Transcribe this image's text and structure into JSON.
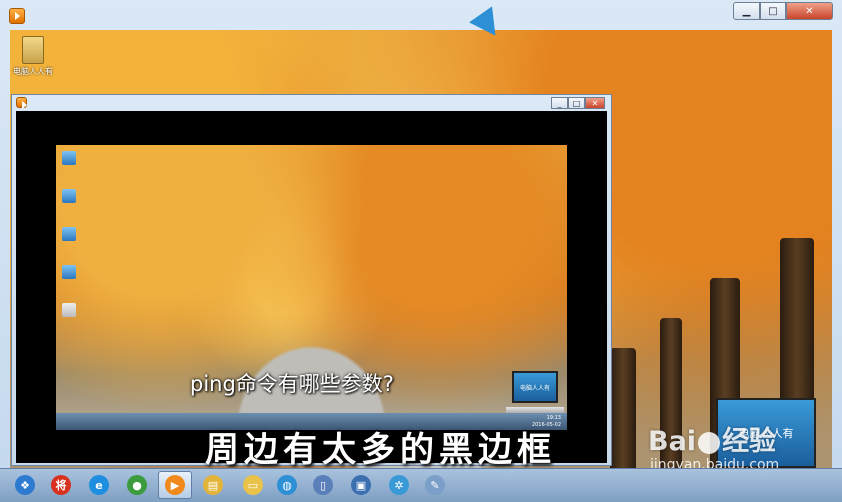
{
  "window": {
    "minimize_glyph": "▁",
    "maximize_glyph": "□",
    "close_glyph": "✕"
  },
  "desktop": {
    "icon_label": "电脑人人有"
  },
  "inner_window": {
    "minimize_glyph": "_",
    "maximize_glyph": "□",
    "close_glyph": "✕"
  },
  "screen": {
    "question_text": "ping命令有哪些参数?",
    "mini_clock_time": "19:13",
    "mini_clock_date": "2016-05-02",
    "laptop_label": "电脑人人有"
  },
  "caption": {
    "text": "周边有太多的黑边框"
  },
  "watermark": {
    "logo_text_left": "Bai",
    "logo_text_right": "经验",
    "url": "jingyan.baidu.com",
    "laptop_label": "电脑人人有"
  },
  "taskbar": {
    "items": [
      {
        "name": "start-orb",
        "glyph": "❖",
        "color": "#2d7bd0"
      },
      {
        "name": "jiang-app-icon",
        "glyph": "将",
        "color": "#d8321e"
      },
      {
        "name": "ie-browser-icon",
        "glyph": "e",
        "color": "#1e8fe0"
      },
      {
        "name": "chrome-browser-icon",
        "glyph": "●",
        "color": "#3c9b3c"
      },
      {
        "name": "media-player-icon",
        "glyph": "▶",
        "color": "#f08a1d"
      },
      {
        "name": "file-explorer-icon",
        "glyph": "▤",
        "color": "#e3b43a"
      },
      {
        "name": "folder-icon",
        "glyph": "▭",
        "color": "#e9c24a"
      },
      {
        "name": "browser-globe-icon",
        "glyph": "◍",
        "color": "#2d8fd5"
      },
      {
        "name": "document-icon",
        "glyph": "▯",
        "color": "#5b7fb8"
      },
      {
        "name": "remote-desktop-icon",
        "glyph": "▣",
        "color": "#3b6fb0"
      },
      {
        "name": "network-icon",
        "glyph": "✲",
        "color": "#3a9ad8"
      },
      {
        "name": "paint-icon",
        "glyph": "✎",
        "color": "#7b9fc8"
      }
    ]
  }
}
